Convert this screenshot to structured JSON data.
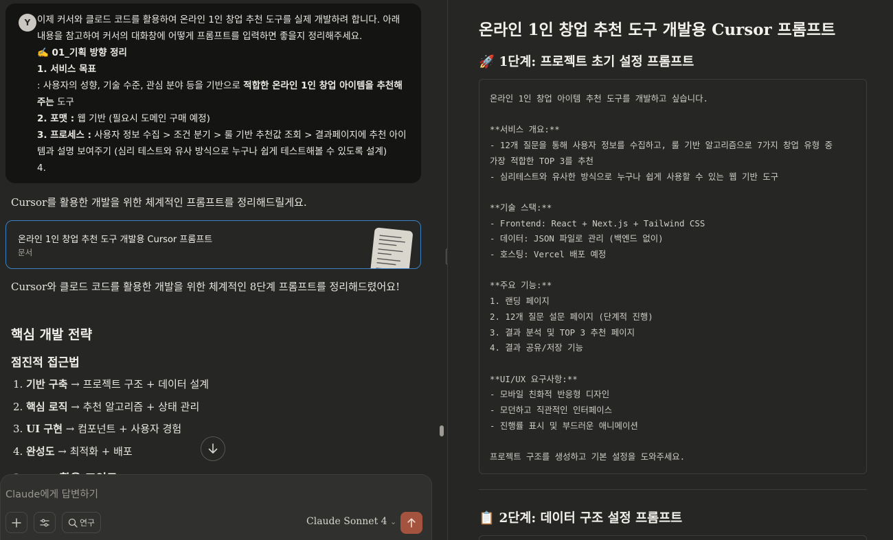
{
  "user_message": {
    "avatar": "Y",
    "line1": "이제 커서와 클로드 코드를 활용하여 온라인 1인 창업 추천 도구를 실제 개발하려 합니다. 아래 내용을 참고하여 커서의 대화창에 어떻게 프롬프트를 입력하면 좋을지 정리해주세요.",
    "heading": "✍️ 01_기획 방향 정리",
    "item1_title": "1. 서비스 목표",
    "item1_prefix": ": 사용자의 성향, 기술 수준, 관심 분야 등을 기반으로 ",
    "item1_bold": "적합한 온라인 1인 창업 아이템을 추천해주는",
    "item1_suffix": " 도구",
    "item2_label": "2. 포맷 :",
    "item2_text": " 웹 기반 (필요시 도메인 구매 예정)",
    "item3_label": "3. 프로세스 :",
    "item3_text": " 사용자 정보 수집 > 조건 분기 > 룰 기반 추천값 조회 > 결과페이지에 추천 아이템과 설명 보여주기 (심리 테스트와 유사 방식으로 누구나 쉽게 테스트해볼 수 있도록 설계)",
    "item4": "4."
  },
  "assistant": {
    "intro": "Cursor를 활용한 개발을 위한 체계적인 프롬프트를 정리해드릴게요.",
    "artifact_title": "온라인 1인 창업 추천 도구 개발용 Cursor 프롬프트",
    "artifact_type": "문서",
    "summary": "Cursor와 클로드 코드를 활용한 개발을 위한 체계적인 8단계 프롬프트를 정리해드렸어요!",
    "heading_core": "핵심 개발 전략",
    "heading_incremental": "점진적 접근법",
    "steps": [
      {
        "num": "1.",
        "bold": "기반 구축",
        "rest": " → 프로젝트 구조 + 데이터 설계"
      },
      {
        "num": "2.",
        "bold": "핵심 로직",
        "rest": " → 추천 알고리즘 + 상태 관리"
      },
      {
        "num": "3.",
        "bold": "UI 구현",
        "rest": " → 컴포넌트 + 사용자 경험"
      },
      {
        "num": "4.",
        "bold": "완성도",
        "rest": " → 최적화 + 배포"
      }
    ],
    "cut_heading": "Cursor 활용 포인트"
  },
  "composer": {
    "placeholder": "Claude에게 답변하기",
    "research_label": "연구",
    "model": "Claude Sonnet 4"
  },
  "artifact": {
    "title": "온라인 1인 창업 추천 도구 개발용 Cursor 프롬프트",
    "step1_heading": "🚀 1단계: 프로젝트 초기 설정 프롬프트",
    "step1_code": "온라인 1인 창업 아이템 추천 도구를 개발하고 싶습니다.\n\n**서비스 개요:**\n- 12개 질문을 통해 사용자 정보를 수집하고, 룰 기반 알고리즘으로 7가지 창업 유형 중\n가장 적합한 TOP 3를 추천\n- 심리테스트와 유사한 방식으로 누구나 쉽게 사용할 수 있는 웹 기반 도구\n\n**기술 스택:**\n- Frontend: React + Next.js + Tailwind CSS\n- 데이터: JSON 파일로 관리 (백엔드 없이)\n- 호스팅: Vercel 배포 예정\n\n**주요 기능:**\n1. 랜딩 페이지\n2. 12개 질문 설문 페이지 (단계적 진행)\n3. 결과 분석 및 TOP 3 추천 페이지\n4. 결과 공유/저장 기능\n\n**UI/UX 요구사항:**\n- 모바일 친화적 반응형 디자인\n- 모던하고 직관적인 인터페이스\n- 진행률 표시 및 부드러운 애니메이션\n\n프로젝트 구조를 생성하고 기본 설정을 도와주세요.",
    "step2_heading": "📋 2단계: 데이터 구조 설정 프롬프트"
  }
}
